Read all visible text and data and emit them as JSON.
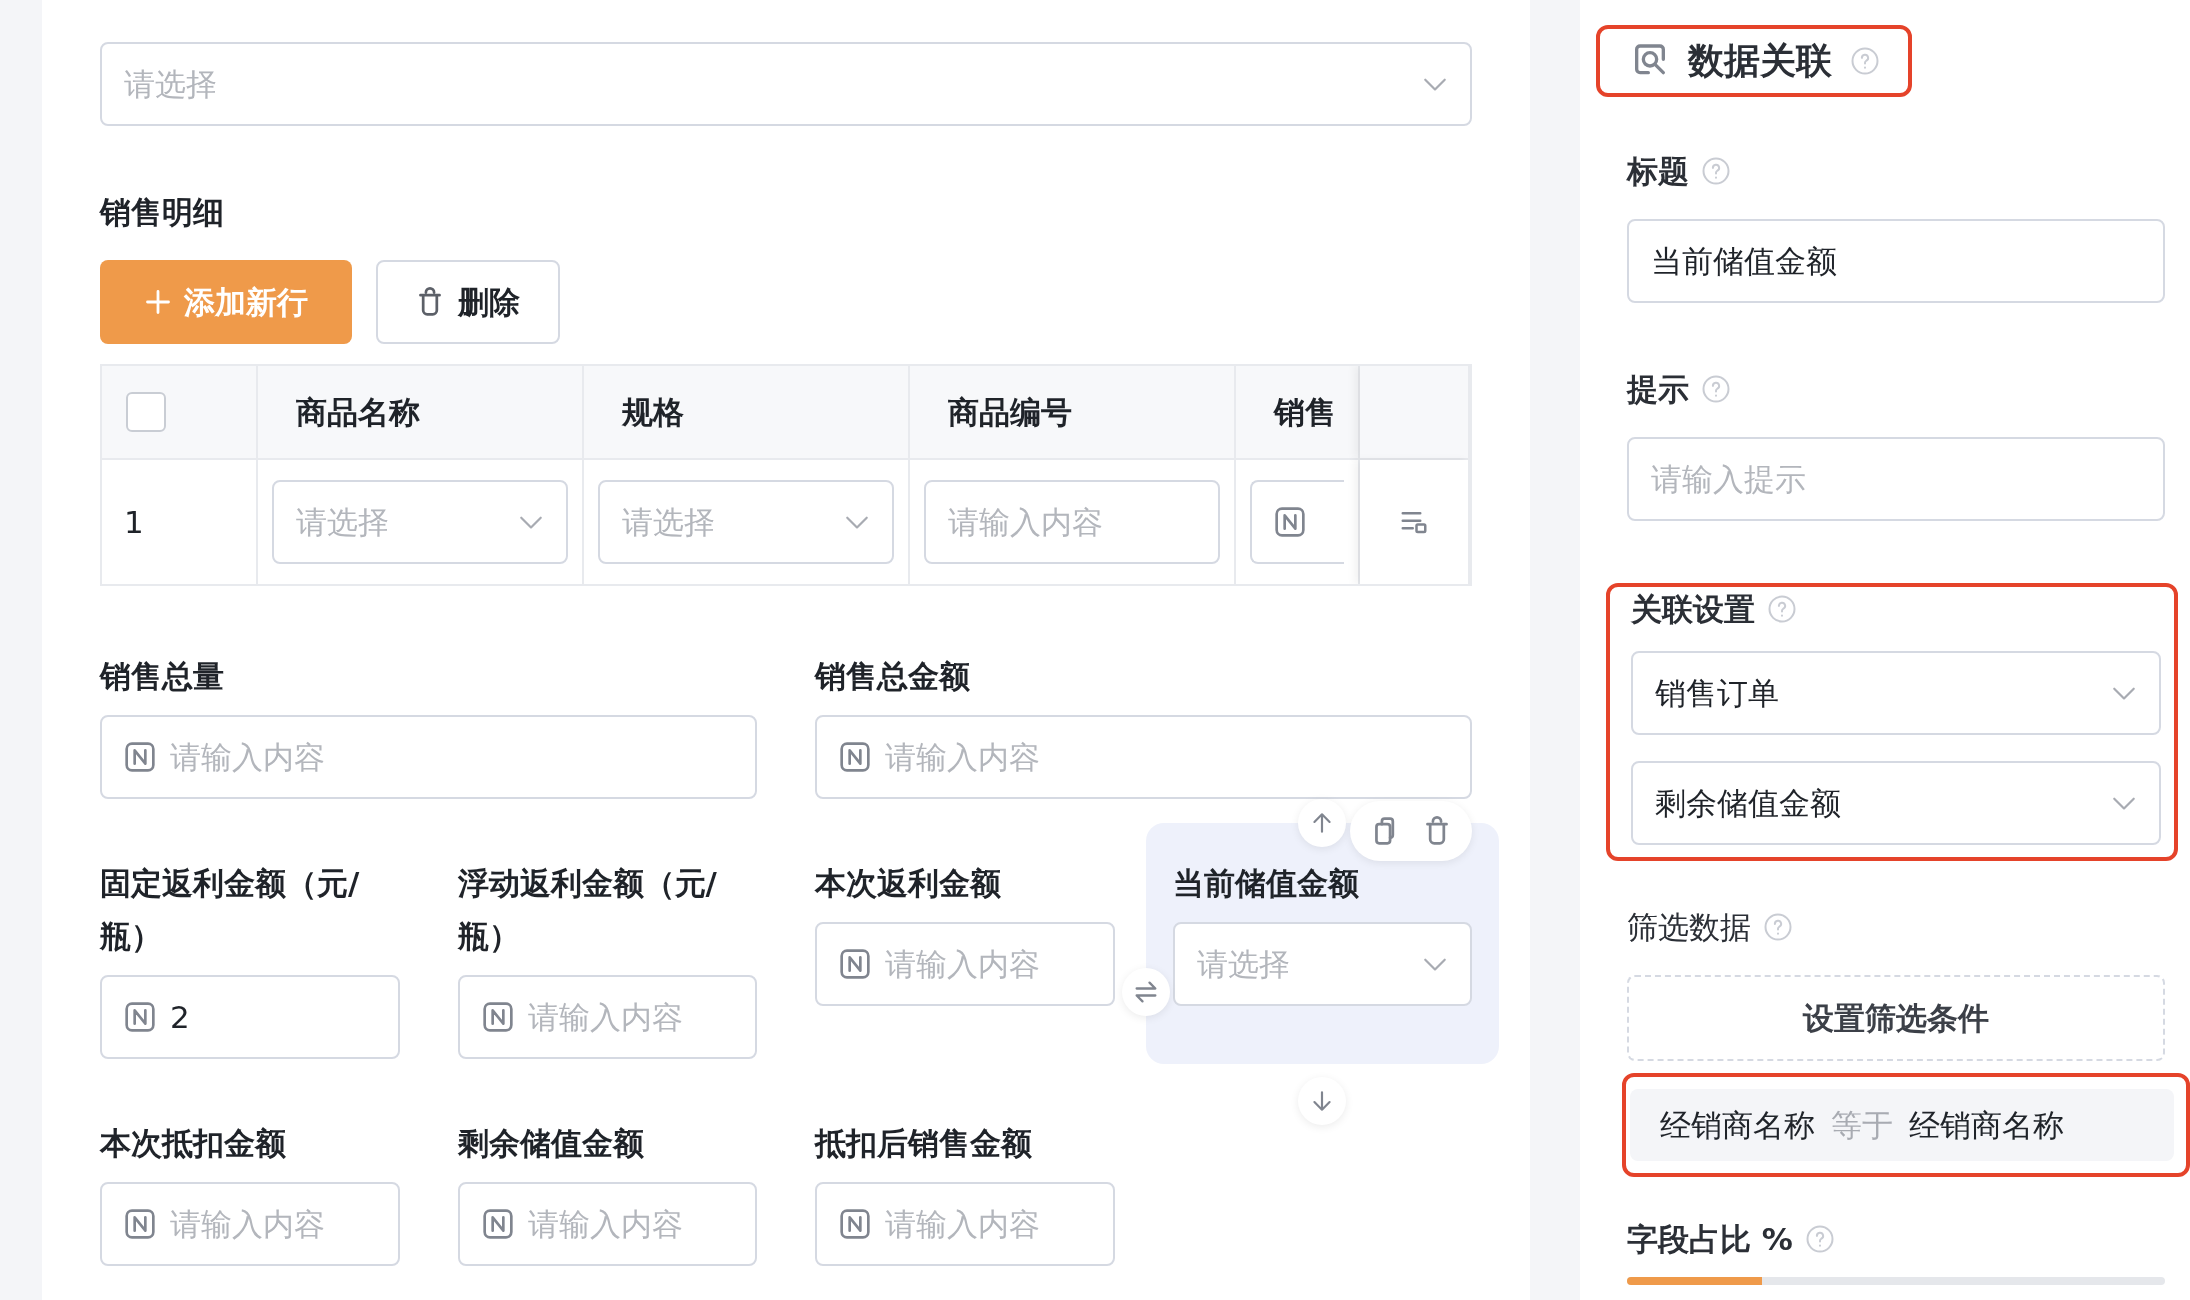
{
  "form": {
    "dealer_field": {
      "placeholder": "请选择"
    },
    "detail_section": {
      "title": "销售明细",
      "buttons": [
        {
          "kind": "primary",
          "label": "添加新行"
        },
        {
          "kind": "outline",
          "label": "删除"
        }
      ],
      "table": {
        "header_checkbox": {
          "checked": false
        },
        "columns": [
          "商品名称",
          "规格",
          "商品编号",
          "销售"
        ],
        "rows": [
          {
            "index": "1",
            "cells": [
              {
                "kind": "select",
                "placeholder": "请选择"
              },
              {
                "kind": "select",
                "placeholder": "请选择"
              },
              {
                "kind": "text",
                "placeholder": "请输入内容"
              },
              {
                "kind": "number"
              }
            ]
          }
        ]
      }
    },
    "field_rows": [
      [
        {
          "label": "销售总量",
          "kind": "number",
          "placeholder": "请输入内容",
          "selected": false
        },
        {
          "label": "销售总金额",
          "kind": "number",
          "placeholder": "请输入内容",
          "selected": false
        }
      ],
      [
        {
          "label": "固定返利金额（元/瓶）",
          "kind": "number",
          "value": "2",
          "selected": false
        },
        {
          "label": "浮动返利金额（元/瓶）",
          "kind": "number",
          "placeholder": "请输入内容",
          "selected": false
        },
        {
          "label": "本次返利金额",
          "kind": "number",
          "placeholder": "请输入内容",
          "selected": false
        },
        {
          "label": "当前储值金额",
          "kind": "select",
          "placeholder": "请选择",
          "selected": true
        }
      ],
      [
        {
          "label": "本次抵扣金额",
          "kind": "number",
          "placeholder": "请输入内容",
          "selected": false
        },
        {
          "label": "剩余储值金额",
          "kind": "number",
          "placeholder": "请输入内容",
          "selected": false
        },
        {
          "label": "抵扣后销售金额",
          "kind": "number",
          "placeholder": "请输入内容",
          "selected": false
        }
      ]
    ]
  },
  "properties": {
    "header": {
      "title": "数据关联",
      "highlighted": true
    },
    "title_field": {
      "label": "标题",
      "value": "当前储值金额"
    },
    "hint_field": {
      "label": "提示",
      "placeholder": "请输入提示"
    },
    "link_settings": {
      "label": "关联设置",
      "highlighted": true,
      "selects": [
        "销售订单",
        "剩余储值金额"
      ]
    },
    "filter": {
      "label": "筛选数据",
      "button": "设置筛选条件",
      "condition": {
        "field": "经销商名称",
        "operator": "等于",
        "value": "经销商名称",
        "highlighted": true
      }
    },
    "ratio": {
      "label": "字段占比 %",
      "level": 0.25
    }
  }
}
